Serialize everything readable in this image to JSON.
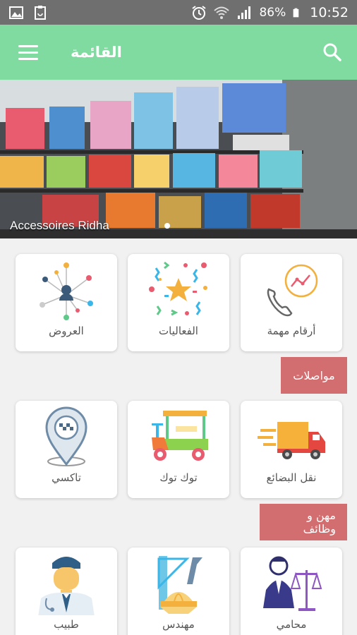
{
  "status_bar": {
    "battery": "86%",
    "time": "10:52"
  },
  "header": {
    "title": "القائمة"
  },
  "banner": {
    "caption": "Accessoires Ridha"
  },
  "row1": [
    {
      "label": "العروض",
      "icon": "network-nodes-icon"
    },
    {
      "label": "الفعاليات",
      "icon": "confetti-star-icon"
    },
    {
      "label": "أرقام مهمة",
      "icon": "phone-chart-icon"
    }
  ],
  "section_transport": {
    "title": "مواصلات"
  },
  "row2": [
    {
      "label": "تاكسي",
      "icon": "taxi-pin-icon"
    },
    {
      "label": "توك توك",
      "icon": "tuk-tuk-icon"
    },
    {
      "label": "نقل البضائع",
      "icon": "delivery-truck-icon"
    }
  ],
  "section_jobs": {
    "title": "مهن و وظائف"
  },
  "row3": [
    {
      "label": "طبيب",
      "icon": "doctor-icon"
    },
    {
      "label": "مهندس",
      "icon": "engineer-tools-icon"
    },
    {
      "label": "محامي",
      "icon": "lawyer-scales-icon"
    }
  ],
  "colors": {
    "app_bar": "#7fdba0",
    "section_header": "#d36e70",
    "status_bar": "#6f6f6f"
  }
}
